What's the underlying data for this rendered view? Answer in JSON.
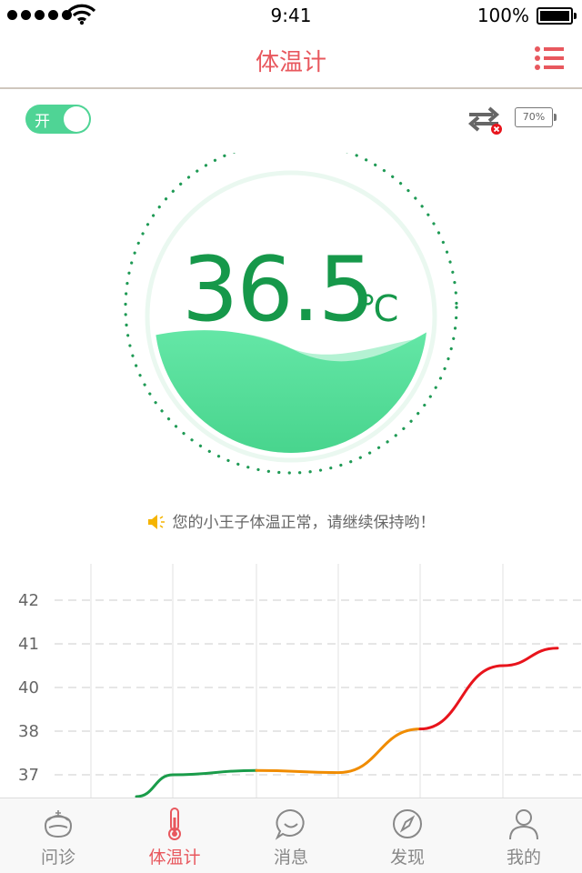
{
  "status_bar": {
    "time": "9:41",
    "battery": "100%"
  },
  "header": {
    "title": "体温计"
  },
  "controls": {
    "toggle_label": "开",
    "device_battery": "70%"
  },
  "reading": {
    "value": "36.5",
    "unit": "℃",
    "level": 0.4
  },
  "notice": {
    "text": "您的小王子体温正常，请继续保持哟！"
  },
  "colors": {
    "accent": "#e8585e",
    "green": "#16984a",
    "wave": "#55dd9a",
    "orange": "#f08c00",
    "red": "#e8141c"
  },
  "chart_data": {
    "type": "line",
    "y_ticks": [
      "42",
      "41",
      "40",
      "38",
      "37"
    ],
    "x": [
      0,
      1,
      2,
      3,
      4,
      5,
      6
    ],
    "y": [
      36.5,
      37,
      37.1,
      37.05,
      38.1,
      40.5,
      40.9
    ],
    "segments": [
      {
        "color": "#1a9c4a",
        "from": 0,
        "to": 2
      },
      {
        "color": "#f08c00",
        "from": 2,
        "to": 4
      },
      {
        "color": "#e8141c",
        "from": 4,
        "to": 6
      }
    ],
    "grid": true
  },
  "tabs": [
    {
      "label": "问诊",
      "icon": "doctor-icon",
      "active": false
    },
    {
      "label": "体温计",
      "icon": "thermometer-icon",
      "active": true
    },
    {
      "label": "消息",
      "icon": "message-icon",
      "active": false
    },
    {
      "label": "发现",
      "icon": "compass-icon",
      "active": false
    },
    {
      "label": "我的",
      "icon": "person-icon",
      "active": false
    }
  ]
}
